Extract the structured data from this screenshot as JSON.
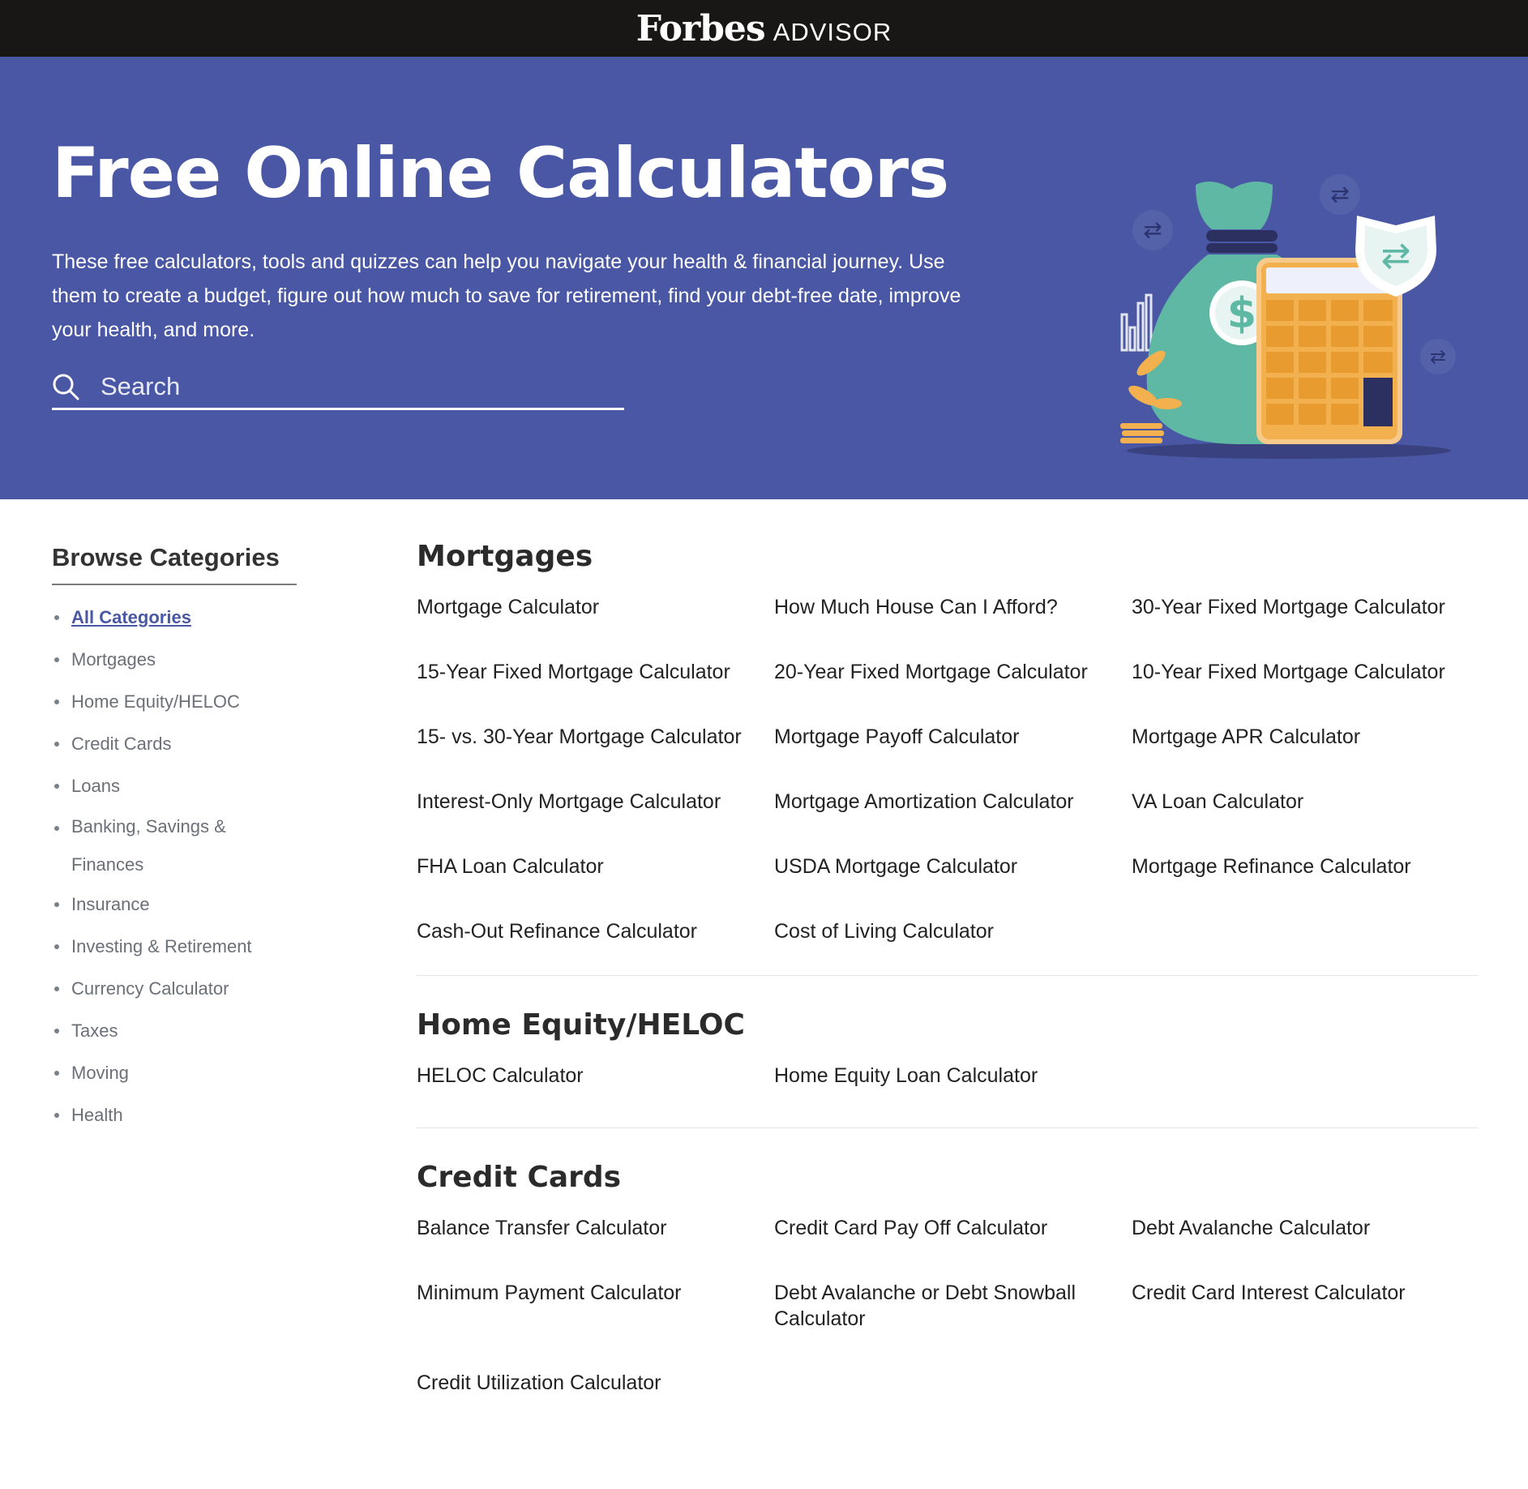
{
  "header": {
    "logo_main": "Forbes",
    "logo_sub": "ADVISOR"
  },
  "hero": {
    "title": "Free Online Calculators",
    "description": "These free calculators, tools and quizzes can help you navigate your health & financial journey. Use them to create a budget, figure out how much to save for retirement, find your debt-free date, improve your health, and more.",
    "search_placeholder": "Search"
  },
  "sidebar": {
    "title": "Browse Categories",
    "items": [
      "All Categories",
      "Mortgages",
      "Home Equity/HELOC",
      "Credit Cards",
      "Loans",
      "Banking, Savings & Finances",
      "Insurance",
      "Investing & Retirement",
      "Currency Calculator",
      "Taxes",
      "Moving",
      "Health"
    ]
  },
  "sections": {
    "mortgages": {
      "title": "Mortgages",
      "links": [
        "Mortgage Calculator",
        "How Much House Can I Afford?",
        "30-Year Fixed Mortgage Calculator",
        "15-Year Fixed Mortgage Calculator",
        "20-Year Fixed Mortgage Calculator",
        "10-Year Fixed Mortgage Calculator",
        "15- vs. 30-Year Mortgage Calculator",
        "Mortgage Payoff Calculator",
        "Mortgage APR Calculator",
        "Interest-Only Mortgage Calculator",
        "Mortgage Amortization Calculator",
        "VA Loan Calculator",
        "FHA Loan Calculator",
        "USDA Mortgage Calculator",
        "Mortgage Refinance Calculator",
        "Cash-Out Refinance Calculator",
        "Cost of Living Calculator"
      ]
    },
    "heloc": {
      "title": "Home Equity/HELOC",
      "links": [
        "HELOC Calculator",
        "Home Equity Loan Calculator"
      ]
    },
    "credit_cards": {
      "title": "Credit Cards",
      "links": [
        "Balance Transfer Calculator",
        "Credit Card Pay Off Calculator",
        "Debt Avalanche Calculator",
        "Minimum Payment Calculator",
        "Debt Avalanche or Debt Snowball Calculator",
        "Credit Card Interest Calculator",
        "Credit Utilization Calculator"
      ]
    }
  },
  "colors": {
    "hero_bg": "#4957a4",
    "topbar_bg": "#181716",
    "accent": "#4957a4"
  }
}
